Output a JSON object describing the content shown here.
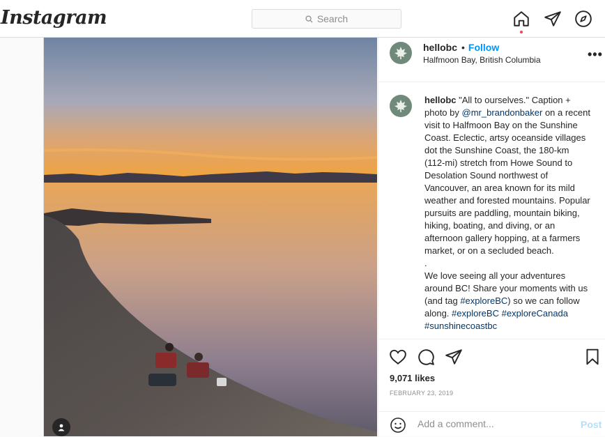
{
  "app": {
    "logo": "Instagram"
  },
  "search": {
    "placeholder": "Search"
  },
  "nav": {
    "icons": [
      "home-icon",
      "direct-icon",
      "explore-icon"
    ]
  },
  "post": {
    "username": "hellobc",
    "separator": "•",
    "follow_label": "Follow",
    "location": "Halfmoon Bay, British Columbia",
    "more_label": "•••",
    "caption": {
      "username": "hellobc",
      "text1": " \"All to ourselves.\" Caption + photo by ",
      "mention": "@mr_brandonbaker",
      "text2": " on a recent visit to Halfmoon Bay on the Sunshine Coast. Eclectic, artsy oceanside villages dot the Sunshine Coast, the 180-km (112-mi) stretch from Howe Sound to Desolation Sound northwest of Vancouver, an area known for its mild weather and forested mountains. Popular pursuits are paddling, mountain biking, hiking, boating, and diving, or an afternoon gallery hopping, at a farmers market, or on a secluded beach.",
      "dot": ".",
      "text3": "We love seeing all your adventures around BC! Share your moments with us (and tag ",
      "tag1": "#exploreBC",
      "text4": ") so we can follow along. ",
      "tag2": "#exploreBC",
      "tag3": "#exploreCanada",
      "tag4": "#sunshinecoastbc"
    },
    "likes": "9,071 likes",
    "date": "FEBRUARY 23, 2019",
    "comment_placeholder": "Add a comment...",
    "post_label": "Post"
  },
  "colors": {
    "follow": "#0095f6",
    "link": "#00376b",
    "notification_dot": "#ed4956"
  }
}
